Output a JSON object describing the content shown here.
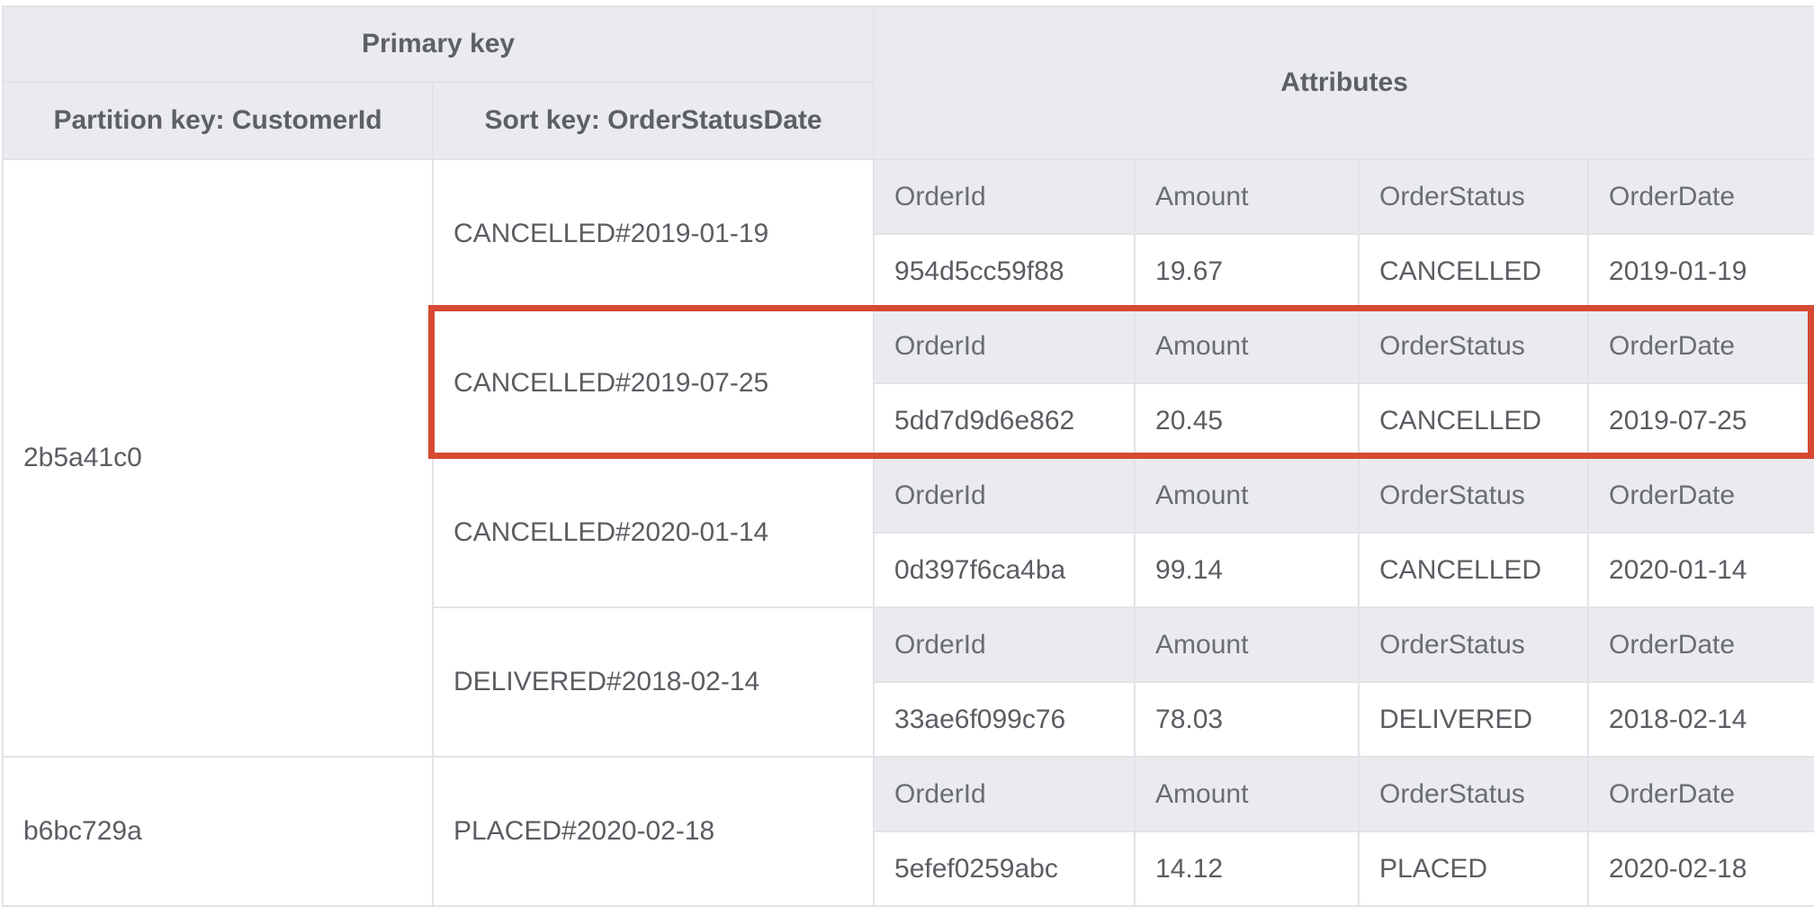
{
  "header": {
    "primary_key": "Primary key",
    "attributes": "Attributes",
    "partition_key": "Partition key: CustomerId",
    "sort_key": "Sort key: OrderStatusDate"
  },
  "attribute_names": [
    "OrderId",
    "Amount",
    "OrderStatus",
    "OrderDate"
  ],
  "highlight_color": "#d64a33",
  "groups": [
    {
      "customer_id": "2b5a41c0",
      "items": [
        {
          "sort_key": "CANCELLED#2019-01-19",
          "values": [
            "954d5cc59f88",
            "19.67",
            "CANCELLED",
            "2019-01-19"
          ]
        },
        {
          "sort_key": "CANCELLED#2019-07-25",
          "values": [
            "5dd7d9d6e862",
            "20.45",
            "CANCELLED",
            "2019-07-25"
          ],
          "highlighted": true
        },
        {
          "sort_key": "CANCELLED#2020-01-14",
          "values": [
            "0d397f6ca4ba",
            "99.14",
            "CANCELLED",
            "2020-01-14"
          ]
        },
        {
          "sort_key": "DELIVERED#2018-02-14",
          "values": [
            "33ae6f099c76",
            "78.03",
            "DELIVERED",
            "2018-02-14"
          ]
        }
      ]
    },
    {
      "customer_id": "b6bc729a",
      "items": [
        {
          "sort_key": "PLACED#2020-02-18",
          "values": [
            "5efef0259abc",
            "14.12",
            "PLACED",
            "2020-02-18"
          ]
        }
      ]
    }
  ]
}
